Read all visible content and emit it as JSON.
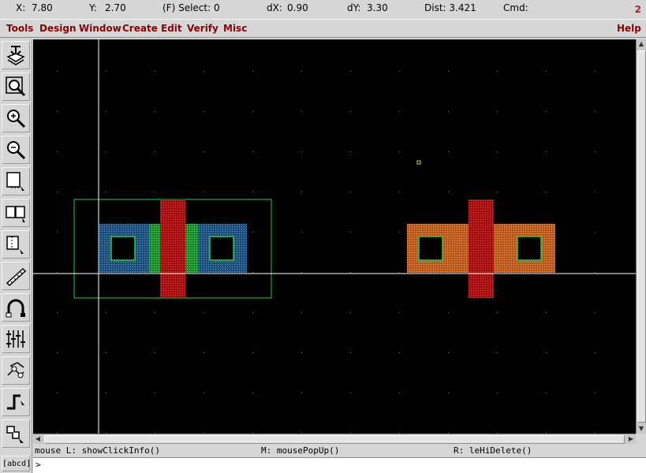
{
  "status": {
    "x_label": "X:",
    "x_value": "7.80",
    "y_label": "Y:",
    "y_value": "2.70",
    "select": "(F) Select: 0",
    "dx_label": "dX:",
    "dx_value": "0.90",
    "dy_label": "dY:",
    "dy_value": "3.30",
    "dist": "Dist: 3.421",
    "cmd": "Cmd:",
    "window_number": "2"
  },
  "menu": {
    "items": [
      "Tools",
      "Design",
      "Window",
      "Create",
      "Edit",
      "Verify",
      "Misc"
    ],
    "help": "Help"
  },
  "toolbar": {
    "icons": [
      "save-icon",
      "fit-view-icon",
      "zoom-in-icon",
      "zoom-out-icon",
      "stretch-icon",
      "copy-icon",
      "move-icon",
      "ruler-icon",
      "undo-icon",
      "instance-icon",
      "path-icon",
      "wire-icon",
      "polygon-icon"
    ],
    "label_button": "[abcd]"
  },
  "mouse": {
    "left": "mouse L: showClickInfo()",
    "middle": "M: mousePopUp()",
    "right": "R: leHiDelete()"
  },
  "command": {
    "prompt": ">",
    "value": ""
  },
  "colors": {
    "canvas": "#000000",
    "grid_dot": "#7a7a7a",
    "crosshair": "#ffffff",
    "diffusion_blue": "#2d6fa8",
    "poly_red": "#c81e1e",
    "contact_green": "#2ecc40",
    "well_outline": "#2ecc40",
    "diffusion_orange": "#d9702a",
    "menu_text": "#8b0000"
  }
}
